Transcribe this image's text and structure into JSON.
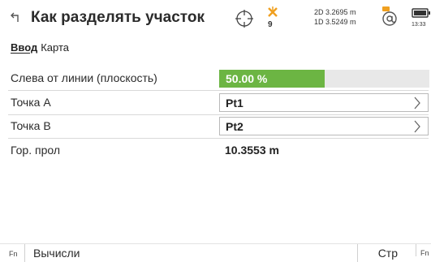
{
  "header": {
    "title": "Как разделять участок",
    "satellite_count": "9",
    "precision_2d": "2D 3.2695 m",
    "precision_1d": "1D 3.5249 m",
    "clock": "13:33",
    "icons": [
      "back-icon",
      "crosshair-icon",
      "satellite-icon",
      "at-icon",
      "battery-icon"
    ]
  },
  "tabs": [
    {
      "label": "Ввод",
      "active": true
    },
    {
      "label": "Карта",
      "active": false
    }
  ],
  "form": {
    "left_of_line": {
      "label": "Слева от линии (плоскость)",
      "value": "50.00 %",
      "fill_fraction": 0.5
    },
    "point_a": {
      "label": "Точка A",
      "value": "Pt1"
    },
    "point_b": {
      "label": "Точка B",
      "value": "Pt2"
    },
    "hor_dist": {
      "label": "Гор. прол",
      "value": "10.3553 m"
    }
  },
  "footer": {
    "fn_left": "Fn",
    "compute": "Вычисли",
    "page": "Стр",
    "fn_right": "Fn"
  },
  "colors": {
    "progress_fill": "#6cb543",
    "progress_track": "#e8e8e8",
    "accent": "#f0a020"
  }
}
